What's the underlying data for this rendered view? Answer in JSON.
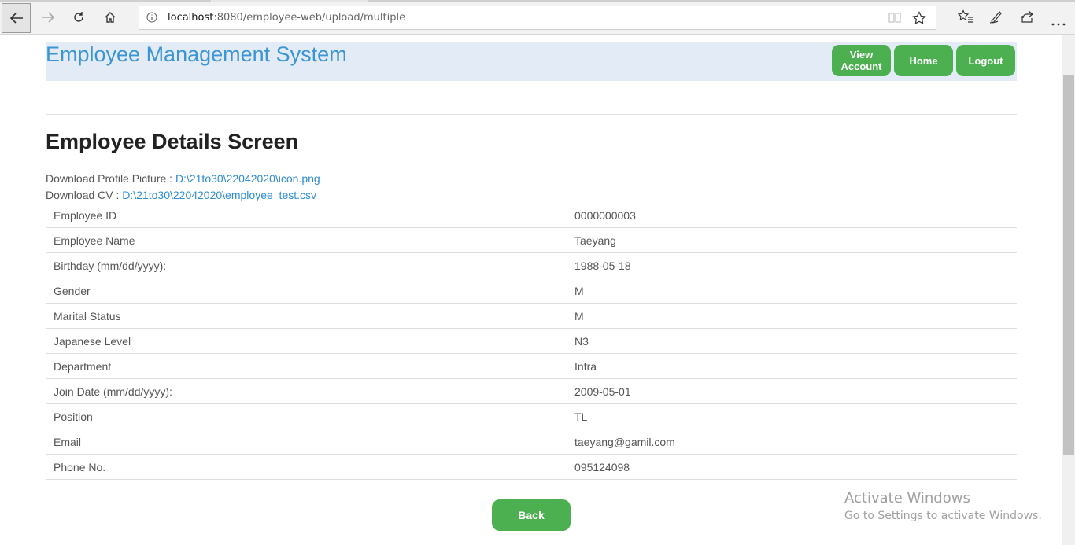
{
  "browser": {
    "url_host": "localhost",
    "url_rest": ":8080/employee-web/upload/multiple"
  },
  "header": {
    "title": "Employee Management System",
    "buttons": {
      "view_account": "View Account",
      "home": "Home",
      "logout": "Logout"
    },
    "colors": {
      "title": "#3c96d3",
      "button": "#4caf50",
      "background": "#e3ebf7"
    }
  },
  "page": {
    "title": "Employee Details Screen",
    "downloads": {
      "picture_label": "Download Profile Picture : ",
      "picture_link": "D:\\21to30\\22042020\\icon.png",
      "cv_label": "Download CV : ",
      "cv_link": "D:\\21to30\\22042020\\employee_test.csv"
    },
    "details": [
      {
        "label": "Employee ID",
        "value": "0000000003"
      },
      {
        "label": "Employee Name",
        "value": "Taeyang"
      },
      {
        "label": "Birthday (mm/dd/yyyy):",
        "value": "1988-05-18"
      },
      {
        "label": "Gender",
        "value": "M"
      },
      {
        "label": "Marital Status",
        "value": "M"
      },
      {
        "label": "Japanese Level",
        "value": "N3"
      },
      {
        "label": "Department",
        "value": "Infra"
      },
      {
        "label": "Join Date (mm/dd/yyyy):",
        "value": "2009-05-01"
      },
      {
        "label": "Position",
        "value": "TL"
      },
      {
        "label": "Email",
        "value": "taeyang@gamil.com"
      },
      {
        "label": "Phone No.",
        "value": "095124098"
      }
    ],
    "back_label": "Back"
  },
  "watermark": {
    "line1": "Activate Windows",
    "line2": "Go to Settings to activate Windows."
  }
}
